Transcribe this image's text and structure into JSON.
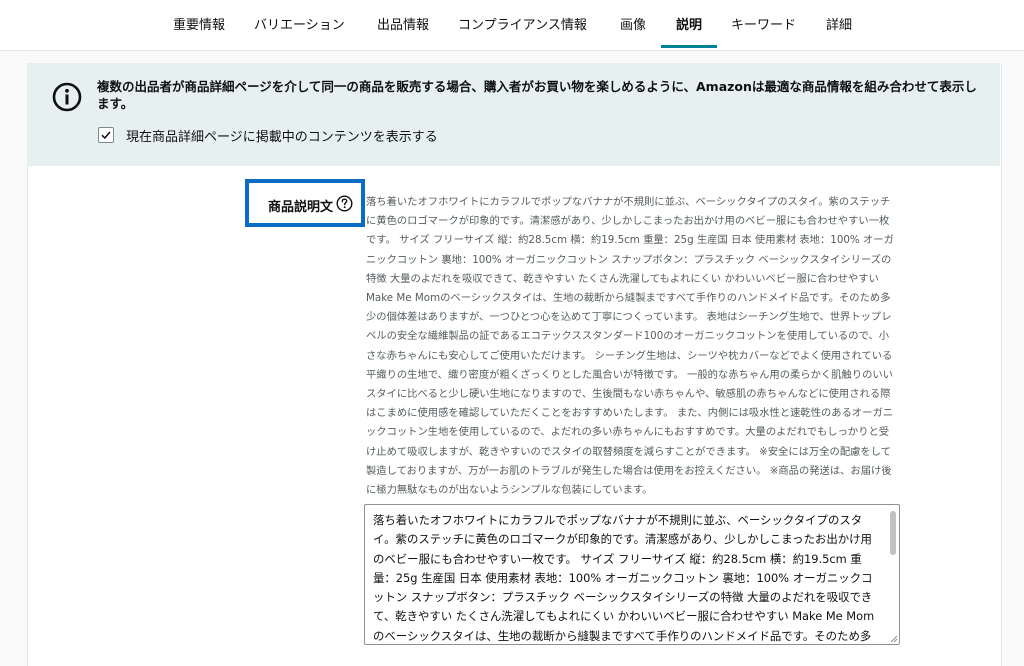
{
  "tabs": [
    {
      "label": "重要情報",
      "active": false
    },
    {
      "label": "バリエーション",
      "active": false
    },
    {
      "label": "出品情報",
      "active": false
    },
    {
      "label": "コンプライアンス情報",
      "active": false
    },
    {
      "label": "画像",
      "active": false
    },
    {
      "label": "説明",
      "active": true
    },
    {
      "label": "キーワード",
      "active": false
    },
    {
      "label": "詳細",
      "active": false
    }
  ],
  "banner": {
    "icon": "info-icon",
    "text": "複数の出品者が商品詳細ページを介して同一の商品を販売する場合、購入者がお買い物を楽しめるように、Amazonは最適な商品情報を組み合わせて表示します。",
    "checkbox_checked": true,
    "checkbox_label": "現在商品詳細ページに掲載中のコンテンツを表示する"
  },
  "field": {
    "label": "商品説明文",
    "help_icon": "question-circle-icon",
    "highlight_color": "#0a6cc4"
  },
  "live_content": "落ち着いたオフホワイトにカラフルでポップなバナナが不規則に並ぶ、ベーシックタイプのスタイ。紫のステッチに黄色のロゴマークが印象的です。清潔感があり、少しかしこまったお出かけ用のベビー服にも合わせやすい一枚です。 サイズ フリーサイズ 縦：約28.5cm 横：約19.5cm 重量：25g 生産国 日本 使用素材 表地：100% オーガニックコットン 裏地：100% オーガニックコットン スナップボタン：プラスチック ベーシックスタイシリーズの特徴 大量のよだれを吸収できて、乾きやすい たくさん洗濯してもよれにくい かわいいベビー服に合わせやすい Make Me Momのベーシックスタイは、生地の裁断から縫製まですべて手作りのハンドメイド品です。そのため多少の個体差はありますが、一つひとつ心を込めて丁寧につくっています。 表地はシーチング生地で、世界トップレベルの安全な繊維製品の証であるエコテックススタンダード100のオーガニックコットンを使用しているので、小さな赤ちゃんにも安心してご使用いただけます。 シーチング生地は、シーツや枕カバーなどでよく使用されている平織りの生地で、織り密度が粗くざっくりとした風合いが特徴です。 一般的な赤ちゃん用の柔らかく肌触りのいいスタイに比べると少し硬い生地になりますので、生後間もない赤ちゃんや、敏感肌の赤ちゃんなどに使用される際はこまめに使用感を確認していただくことをおすすめいたします。 また、内側には吸水性と速乾性のあるオーガニックコットン生地を使用しているので、よだれの多い赤ちゃんにもおすすめです。大量のよだれでもしっかりと受け止めて吸収しますが、乾きやすいのでスタイの取替頻度を減らすことができます。 ※安全には万全の配慮をして製造しておりますが、万が一お肌のトラブルが発生した場合は使用をお控えください。 ※商品の発送は、お届け後に極力無駄なものが出ないようシンプルな包装にしています。",
  "editor_value": "落ち着いたオフホワイトにカラフルでポップなバナナが不規則に並ぶ、ベーシックタイプのスタイ。紫のステッチに黄色のロゴマークが印象的です。清潔感があり、少しかしこまったお出かけ用のベビー服にも合わせやすい一枚です。 サイズ フリーサイズ 縦：約28.5cm 横：約19.5cm 重量：25g 生産国 日本 使用素材 表地：100% オーガニックコットン 裏地：100% オーガニックコットン スナップボタン：プラスチック ベーシックスタイシリーズの特徴 大量のよだれを吸収できて、乾きやすい たくさん洗濯してもよれにくい かわいいベビー服に合わせやすい Make Me Momのベーシックスタイは、生地の裁断から縫製まですべて手作りのハンドメイド品です。そのため多少の個体差はありますが、一つひとつ心を込めて"
}
